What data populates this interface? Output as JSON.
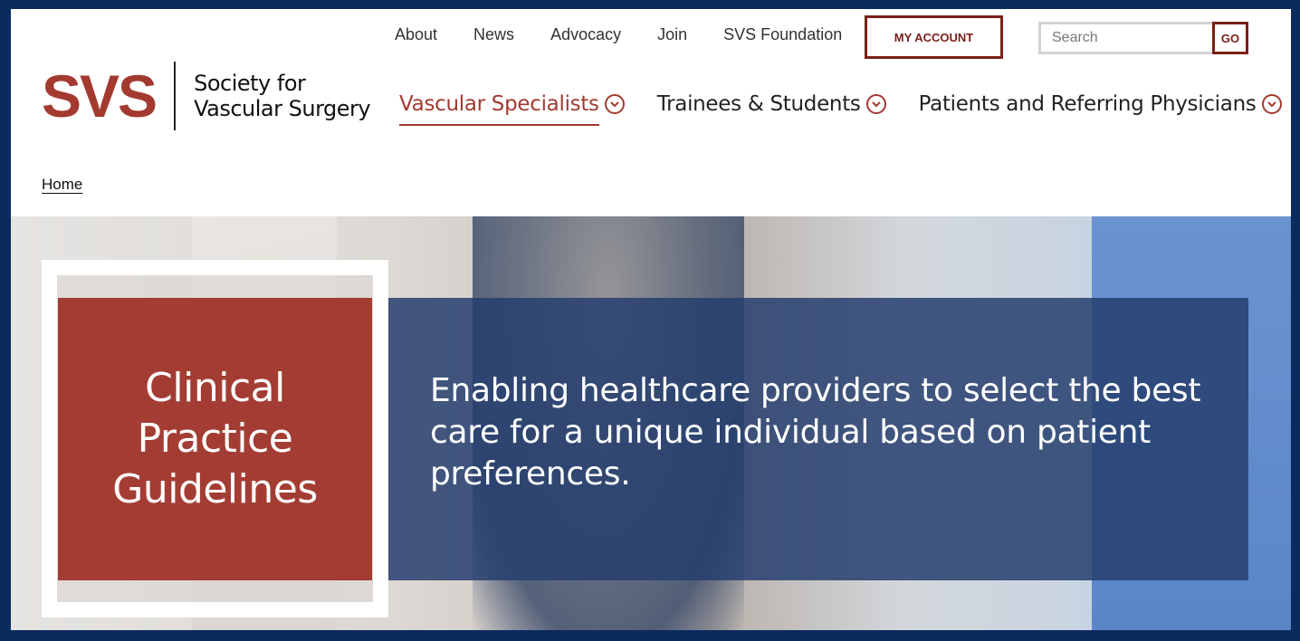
{
  "logo": {
    "mark": "SVS",
    "line1": "Society for",
    "line2": "Vascular Surgery"
  },
  "util_nav": {
    "items": [
      {
        "label": "About"
      },
      {
        "label": "News"
      },
      {
        "label": "Advocacy"
      },
      {
        "label": "Join"
      },
      {
        "label": "SVS Foundation"
      }
    ]
  },
  "account": {
    "label": "MY ACCOUNT"
  },
  "search": {
    "placeholder": "Search",
    "go_label": "GO"
  },
  "main_nav": {
    "items": [
      {
        "label": "Vascular Specialists",
        "active": true
      },
      {
        "label": "Trainees & Students",
        "active": false
      },
      {
        "label": "Patients and Referring Physicians",
        "active": false
      }
    ]
  },
  "breadcrumb": {
    "home": "Home"
  },
  "hero": {
    "title": "Clinical Practice Guidelines",
    "tagline": "Enabling healthcare providers to select the best care for a unique individual based on patient preferences."
  },
  "colors": {
    "brand_red": "#a33a30",
    "dark_red": "#7a1f18",
    "hero_blue": "#263e6e",
    "frame": "#0b2a5e"
  }
}
